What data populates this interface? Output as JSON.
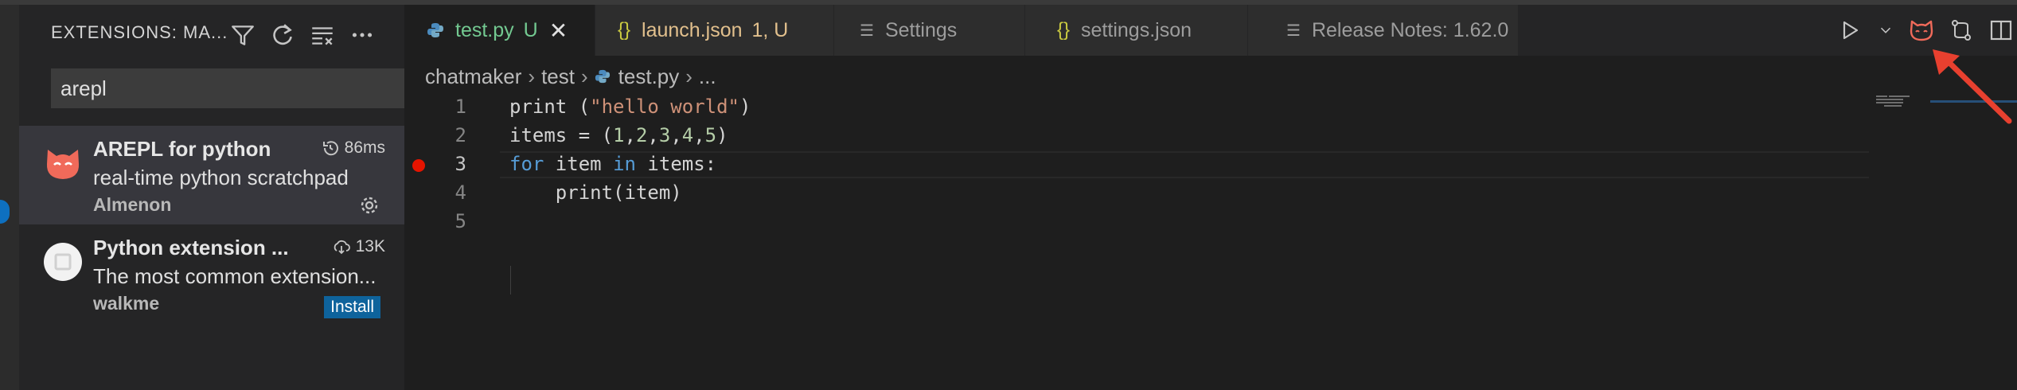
{
  "sidebar": {
    "title": "EXTENSIONS: MA...",
    "search_value": "arepl",
    "extensions": [
      {
        "name": "AREPL for python",
        "meta": "86ms",
        "description": "real-time python scratchpad",
        "publisher": "Almenon"
      },
      {
        "name": "Python extension ...",
        "meta": "13K",
        "description": "The most common extension...",
        "publisher": "walkme",
        "action": "Install"
      }
    ]
  },
  "tabs": [
    {
      "label": "test.py",
      "flag": "U",
      "icon": "python-icon",
      "active": true
    },
    {
      "label": "launch.json",
      "flag": "1, U",
      "icon": "json-braces-icon"
    },
    {
      "label": "Settings",
      "icon": "settings-lines-icon"
    },
    {
      "label": "settings.json",
      "icon": "json-braces-icon"
    },
    {
      "label": "Release Notes: 1.62.0",
      "icon": "notes-lines-icon"
    }
  ],
  "breadcrumb": {
    "folder": "chatmaker",
    "subfolder": "test",
    "file": "test.py",
    "more": "..."
  },
  "editor": {
    "line_numbers": [
      "1",
      "2",
      "3",
      "4",
      "5"
    ],
    "current_line": "3",
    "breakpoint_line": "3",
    "code": {
      "l1_fn": "print",
      "l1_paren_open": " (",
      "l1_str": "\"hello world\"",
      "l1_paren_close": ")",
      "l2_pre": "items = (",
      "n1": "1",
      "n2": "2",
      "n3": "3",
      "n4": "4",
      "n5": "5",
      "comma": ",",
      "l2_close": ")",
      "l3_for": "for",
      "l3_item": " item ",
      "l3_in": "in",
      "l3_rest": " items:",
      "l4": "    print(item)"
    }
  },
  "colors": {
    "accent_blue": "#0e70c0",
    "modified_green": "#73c991",
    "json_yellow": "#e2c08d",
    "breakpoint_red": "#e51400",
    "arepl_orange": "#f06a5a",
    "arrow_red": "#e8402f"
  }
}
